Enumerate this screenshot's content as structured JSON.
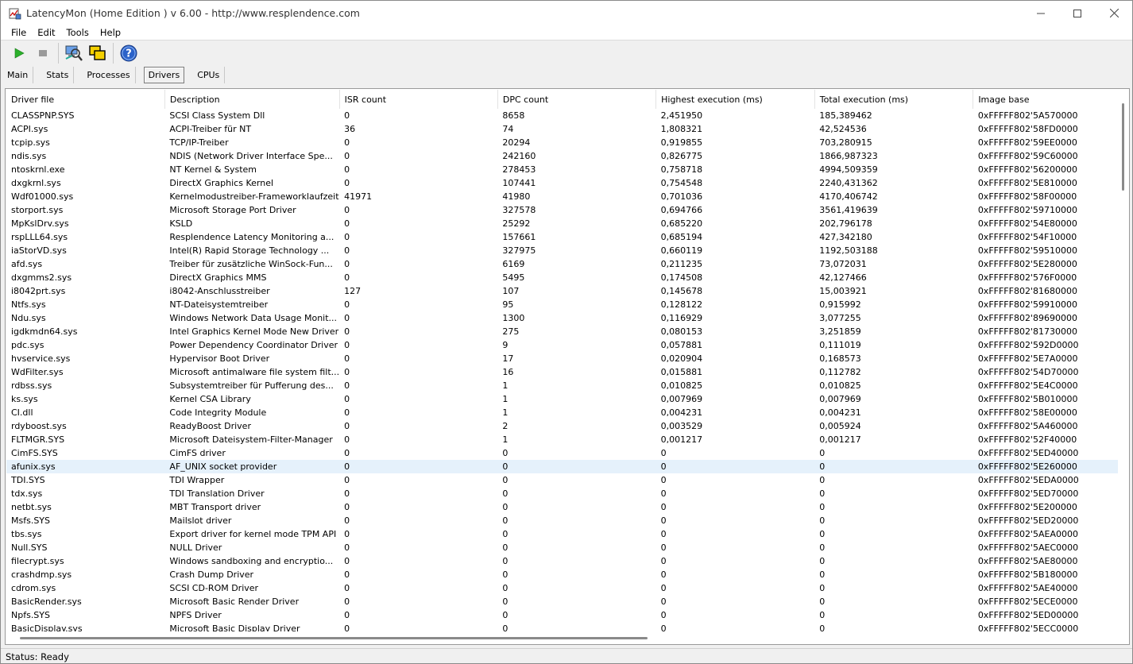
{
  "window": {
    "title": "LatencyMon  (Home Edition )  v 6.00 - http://www.resplendence.com"
  },
  "menu": [
    "File",
    "Edit",
    "Tools",
    "Help"
  ],
  "toolbar": {
    "icons": [
      "play-icon",
      "stop-icon",
      "computer-search-icon",
      "windows-icon",
      "help-icon"
    ]
  },
  "tabs": [
    {
      "label": "Main",
      "active": false
    },
    {
      "label": "Stats",
      "active": false
    },
    {
      "label": "Processes",
      "active": false
    },
    {
      "label": "Drivers",
      "active": true
    },
    {
      "label": "CPUs",
      "active": false
    }
  ],
  "table": {
    "columns": [
      "Driver file",
      "Description",
      "ISR count",
      "DPC count",
      "Highest execution (ms)",
      "Total execution (ms)",
      "Image base"
    ],
    "rows": [
      [
        "CLASSPNP.SYS",
        "SCSI Class System Dll",
        "0",
        "8658",
        "2,451950",
        "185,389462",
        "0xFFFFF802'5A570000"
      ],
      [
        "ACPI.sys",
        "ACPI-Treiber für NT",
        "36",
        "74",
        "1,808321",
        "42,524536",
        "0xFFFFF802'58FD0000"
      ],
      [
        "tcpip.sys",
        "TCP/IP-Treiber",
        "0",
        "20294",
        "0,919855",
        "703,280915",
        "0xFFFFF802'59EE0000"
      ],
      [
        "ndis.sys",
        "NDIS (Network Driver Interface Spe...",
        "0",
        "242160",
        "0,826775",
        "1866,987323",
        "0xFFFFF802'59C60000"
      ],
      [
        "ntoskrnl.exe",
        "NT Kernel & System",
        "0",
        "278453",
        "0,758718",
        "4994,509359",
        "0xFFFFF802'56200000"
      ],
      [
        "dxgkrnl.sys",
        "DirectX Graphics Kernel",
        "0",
        "107441",
        "0,754548",
        "2240,431362",
        "0xFFFFF802'5E810000"
      ],
      [
        "Wdf01000.sys",
        "Kernelmodustreiber-Frameworklaufzeit",
        "41971",
        "41980",
        "0,701036",
        "4170,406742",
        "0xFFFFF802'58F00000"
      ],
      [
        "storport.sys",
        "Microsoft Storage Port Driver",
        "0",
        "327578",
        "0,694766",
        "3561,419639",
        "0xFFFFF802'59710000"
      ],
      [
        "MpKslDrv.sys",
        "KSLD",
        "0",
        "25292",
        "0,685220",
        "202,796178",
        "0xFFFFF802'54E80000"
      ],
      [
        "rspLLL64.sys",
        "Resplendence Latency Monitoring a...",
        "0",
        "157661",
        "0,685194",
        "427,342180",
        "0xFFFFF802'54F10000"
      ],
      [
        "iaStorVD.sys",
        "Intel(R) Rapid Storage Technology ...",
        "0",
        "327975",
        "0,660119",
        "1192,503188",
        "0xFFFFF802'59510000"
      ],
      [
        "afd.sys",
        "Treiber für zusätzliche WinSock-Fun...",
        "0",
        "6169",
        "0,211235",
        "73,072031",
        "0xFFFFF802'5E280000"
      ],
      [
        "dxgmms2.sys",
        "DirectX Graphics MMS",
        "0",
        "5495",
        "0,174508",
        "42,127466",
        "0xFFFFF802'576F0000"
      ],
      [
        "i8042prt.sys",
        "i8042-Anschlusstreiber",
        "127",
        "107",
        "0,145678",
        "15,003921",
        "0xFFFFF802'81680000"
      ],
      [
        "Ntfs.sys",
        "NT-Dateisystemtreiber",
        "0",
        "95",
        "0,128122",
        "0,915992",
        "0xFFFFF802'59910000"
      ],
      [
        "Ndu.sys",
        "Windows Network Data Usage Monit...",
        "0",
        "1300",
        "0,116929",
        "3,077255",
        "0xFFFFF802'89690000"
      ],
      [
        "igdkmdn64.sys",
        "Intel Graphics Kernel Mode New Driver",
        "0",
        "275",
        "0,080153",
        "3,251859",
        "0xFFFFF802'81730000"
      ],
      [
        "pdc.sys",
        "Power Dependency Coordinator Driver",
        "0",
        "9",
        "0,057881",
        "0,111019",
        "0xFFFFF802'592D0000"
      ],
      [
        "hvservice.sys",
        "Hypervisor Boot Driver",
        "0",
        "17",
        "0,020904",
        "0,168573",
        "0xFFFFF802'5E7A0000"
      ],
      [
        "WdFilter.sys",
        "Microsoft antimalware file system filt...",
        "0",
        "16",
        "0,015881",
        "0,112782",
        "0xFFFFF802'54D70000"
      ],
      [
        "rdbss.sys",
        "Subsystemtreiber für Pufferung des...",
        "0",
        "1",
        "0,010825",
        "0,010825",
        "0xFFFFF802'5E4C0000"
      ],
      [
        "ks.sys",
        "Kernel CSA Library",
        "0",
        "1",
        "0,007969",
        "0,007969",
        "0xFFFFF802'5B010000"
      ],
      [
        "CI.dll",
        "Code Integrity Module",
        "0",
        "1",
        "0,004231",
        "0,004231",
        "0xFFFFF802'58E00000"
      ],
      [
        "rdyboost.sys",
        "ReadyBoost Driver",
        "0",
        "2",
        "0,003529",
        "0,005924",
        "0xFFFFF802'5A460000"
      ],
      [
        "FLTMGR.SYS",
        "Microsoft Dateisystem-Filter-Manager",
        "0",
        "1",
        "0,001217",
        "0,001217",
        "0xFFFFF802'52F40000"
      ],
      [
        "CimFS.SYS",
        "CimFS driver",
        "0",
        "0",
        "0",
        "0",
        "0xFFFFF802'5ED40000"
      ],
      [
        "afunix.sys",
        "AF_UNIX socket provider",
        "0",
        "0",
        "0",
        "0",
        "0xFFFFF802'5E260000"
      ],
      [
        "TDI.SYS",
        "TDI Wrapper",
        "0",
        "0",
        "0",
        "0",
        "0xFFFFF802'5EDA0000"
      ],
      [
        "tdx.sys",
        "TDI Translation Driver",
        "0",
        "0",
        "0",
        "0",
        "0xFFFFF802'5ED70000"
      ],
      [
        "netbt.sys",
        "MBT Transport driver",
        "0",
        "0",
        "0",
        "0",
        "0xFFFFF802'5E200000"
      ],
      [
        "Msfs.SYS",
        "Mailslot driver",
        "0",
        "0",
        "0",
        "0",
        "0xFFFFF802'5ED20000"
      ],
      [
        "tbs.sys",
        "Export driver for kernel mode TPM API",
        "0",
        "0",
        "0",
        "0",
        "0xFFFFF802'5AEA0000"
      ],
      [
        "Null.SYS",
        "NULL Driver",
        "0",
        "0",
        "0",
        "0",
        "0xFFFFF802'5AEC0000"
      ],
      [
        "filecrypt.sys",
        "Windows sandboxing and encryptio...",
        "0",
        "0",
        "0",
        "0",
        "0xFFFFF802'5AE80000"
      ],
      [
        "crashdmp.sys",
        "Crash Dump Driver",
        "0",
        "0",
        "0",
        "0",
        "0xFFFFF802'5B180000"
      ],
      [
        "cdrom.sys",
        "SCSI CD-ROM Driver",
        "0",
        "0",
        "0",
        "0",
        "0xFFFFF802'5AE40000"
      ],
      [
        "BasicRender.sys",
        "Microsoft Basic Render Driver",
        "0",
        "0",
        "0",
        "0",
        "0xFFFFF802'5ECE0000"
      ],
      [
        "Npfs.SYS",
        "NPFS Driver",
        "0",
        "0",
        "0",
        "0",
        "0xFFFFF802'5ED00000"
      ],
      [
        "BasicDisplay.sys",
        "Microsoft Basic Display Driver",
        "0",
        "0",
        "0",
        "0",
        "0xFFFFF802'5ECC0000"
      ]
    ],
    "highlighted_row": 26,
    "highlight_color": "#e5f1fb"
  },
  "status": {
    "text": "Status: Ready"
  }
}
